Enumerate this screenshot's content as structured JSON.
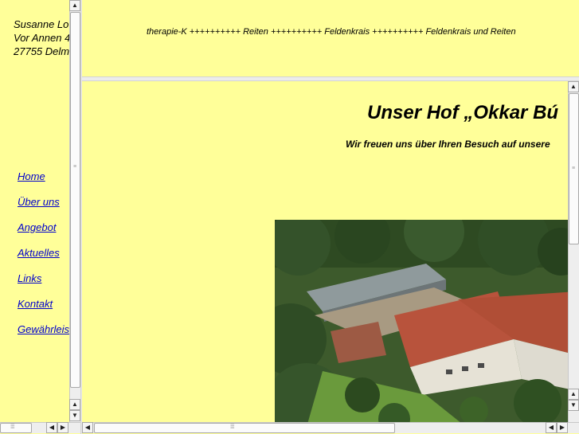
{
  "left": {
    "address": [
      "Susanne Lo",
      "Vor Annen 4",
      "27755 Delm"
    ],
    "nav": [
      {
        "label": "Home"
      },
      {
        "label": "Über uns"
      },
      {
        "label": "Angebot"
      },
      {
        "label": "Aktuelles"
      },
      {
        "label": "Links"
      },
      {
        "label": "Kontakt"
      },
      {
        "label": "Gewährleis"
      }
    ]
  },
  "top": {
    "tagline": "therapie-K ++++++++++ Reiten ++++++++++ Feldenkrais ++++++++++ Feldenkrais und Reiten"
  },
  "main": {
    "title": "Unser Hof „Okkar Bú",
    "subtitle": "Wir freuen uns über Ihren Besuch auf unsere"
  },
  "scroll": {
    "up": "▲",
    "down": "▼",
    "left": "◀",
    "right": "▶",
    "grip_h": "⁞⁞⁞⁞⁞",
    "grip_v": "≡"
  },
  "colors": {
    "background": "#ffff99",
    "link": "#0000cc",
    "scrollbar": "#eeeeee"
  }
}
